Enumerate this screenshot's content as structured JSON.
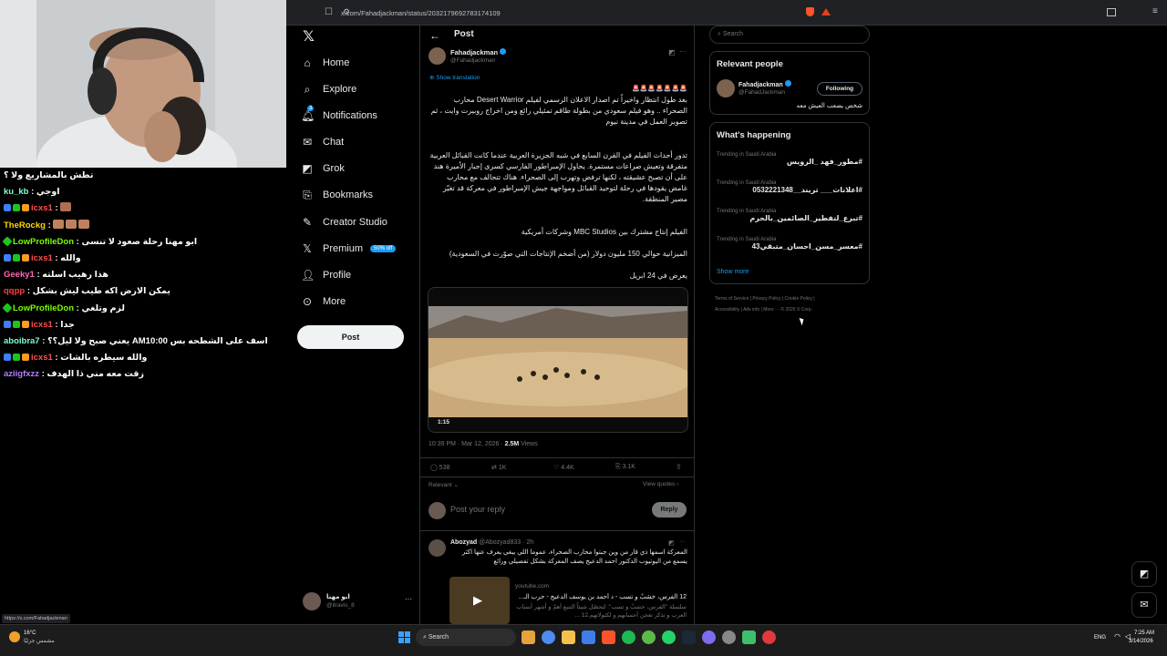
{
  "browser": {
    "url": "x.com/Fahadjackman/status/2032179692783174109",
    "status_url": "https://x.com/Fahadjackman"
  },
  "chat": [
    {
      "user": "",
      "text": "تطش بالمشاريع ولا ؟",
      "color": "#ffffff"
    },
    {
      "user": "ku_kb",
      "text": ": اوجي",
      "color": "#7fffd4"
    },
    {
      "user": "icxs1",
      "text": ":",
      "color": "#ff4d4d"
    },
    {
      "user": "TheRockg",
      "text": ":",
      "color": "#ffd700"
    },
    {
      "user": "LowProfileDon",
      "text": ": ابو مهنا رحلة صعود لا تنسى",
      "color": "#7cfc00"
    },
    {
      "user": "icxs1",
      "text": ": والله",
      "color": "#ff4d4d"
    },
    {
      "user": "Geeky1",
      "text": ": هذا رهيب اسلته",
      "color": "#ff69b4"
    },
    {
      "user": "qqpp",
      "text": ": يمكن الارض اكه طيب ليش بشكل",
      "color": "#ff4040"
    },
    {
      "user": "LowProfileDon",
      "text": ": لزم وتلغي",
      "color": "#7cfc00"
    },
    {
      "user": "icxs1",
      "text": ": جدا",
      "color": "#ff4d4d"
    },
    {
      "user": "aboibra7",
      "text": ": يعني صبح ولا ليل؟؟ AMاسف على الشطحه بس 10:00",
      "color": "#7fffd4"
    },
    {
      "user": "icxs1",
      "text": ": والله سيطره بالشات",
      "color": "#ff4d4d"
    },
    {
      "user": "aziigfxzz",
      "text": ": زقت معه مني ذا الهدف",
      "color": "#b57cff"
    }
  ],
  "nav": {
    "items": [
      "Home",
      "Explore",
      "Notifications",
      "Chat",
      "Grok",
      "Bookmarks",
      "Creator Studio",
      "Premium",
      "Profile",
      "More"
    ],
    "premium_badge": "50% off",
    "notif_count": "3",
    "post_button": "Post",
    "account_name": "ابو مهنا",
    "account_handle": "@itravis_8"
  },
  "post": {
    "header": "Post",
    "author": "Fahadjackman",
    "handle": "@Fahadjackman",
    "show_translation": "Show translation",
    "emojis": "🚨🚨🚨🚨🚨🚨🚨",
    "p1": "بعد طول انتظار واخيراً تم اصدار الاعلان الرسمي لفيلم Desert Warrior محارب الصحراء .. وهو فيلم سعودي من بطولة طاقم تمثيلي رائع ومن اخراج روبيرت وايت ، ثم تصوير العمل في مدينة نيوم",
    "p2": "تدور أحداث الفيلم في القرن السابع في شبه الجزيرة العربية عندما كانت القبائل العربية متفرقة وتعيش صراعات مستمرة. يحاول الإمبراطور الفارسي كسرى إجبار الأميرة هند على أن تصبح عشيقته ، لكنها ترفض وتهرب إلى الصحراء. هناك تتحالف مع محارب غامض يقودها في رحلة لتوحيد القبائل ومواجهة جيش الإمبراطور في معركة قد تغيّر مصير المنطقة.",
    "p3": "الفيلم إنتاج مشترك بين MBC Studios وشركات أمريكية",
    "p4": "الميزانية حوالي 150 مليون دولار (من أضخم الإنتاجات التي صوّرت في السعودية)",
    "p5": "يعرض في 24 ابريل",
    "video_time": "1:15",
    "timestamp": "10:39 PM · Mar 12, 2026 ·",
    "views": "2.5M",
    "views_label": "Views",
    "replies": "538",
    "reposts": "1K",
    "likes": "4.4K",
    "bookmarks": "3.1K",
    "relevant": "Relevant",
    "view_quotes": "View quotes",
    "reply_placeholder": "Post your reply",
    "reply_button": "Reply"
  },
  "reply": {
    "author": "Abozyad",
    "handle": "@Abozyad833 · 2h",
    "text": "المعركة اسمها ذي قار من وين جبتوا محارب الصحراء، عموما اللي يبغى يعرف عنها اكثر يسمع من اليوتيوب الدكتور احمد الدعيج يصف المعركة بشكل تفصيلي ورائع",
    "card_domain": "youtube.com",
    "card_title": "12 الفرس، خشبٌ و تسب - د أحمد بن يوسف الدعيج - حرب الـ...",
    "card_desc": "سلسلة \"الفرس، خشبٌ و تسب\": لتحصّل شيئاً التتبع أهمّ و أشهر أنساب العرب و تذكر تعجن أحسابهم و لكثولاتهم.12 ..."
  },
  "sidebar": {
    "search_placeholder": "Search",
    "relevant_title": "Relevant people",
    "person_name": "Fahadjackman",
    "person_handle": "@FahadJackman",
    "following": "Following",
    "person_bio": "شخص يصعب العيش معه",
    "happening_title": "What's happening",
    "trends": [
      {
        "meta": "Trending in Saudi Arabia",
        "name": "#مطور_فهد _الرويس"
      },
      {
        "meta": "Trending in Saudi Arabia",
        "name": "#اعلانات___ تريند__0532221348"
      },
      {
        "meta": "Trending in Saudi Arabia",
        "name": "#تبرع_لتفطير_الصائمين_بالحرم"
      },
      {
        "meta": "Trending in Saudi Arabia",
        "name": "#معسر_مسن_احسان_متبقي43"
      }
    ],
    "show_more": "Show more",
    "footer": [
      "Terms of Service",
      "|",
      "Privacy Policy",
      "|",
      "Cookie Policy",
      "|",
      "Accessibility",
      "|",
      "Ads info",
      "|",
      "More ···",
      "© 2026 X Corp."
    ]
  },
  "taskbar": {
    "weather_temp": "16°C",
    "weather_desc": "مشمس جزئيًا",
    "search": "Search",
    "lang": "ENG",
    "time": "7:25 AM",
    "date": "3/14/2026"
  }
}
